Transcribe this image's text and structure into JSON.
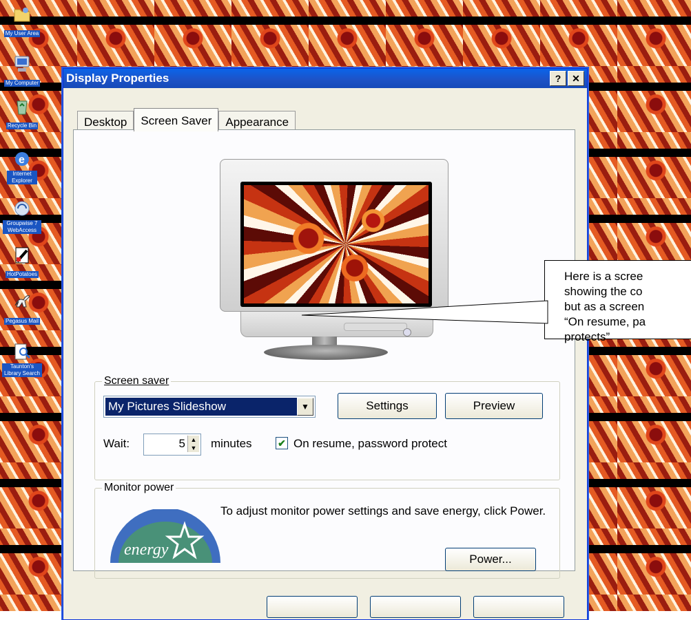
{
  "desktop_icons": [
    {
      "label": "My User Area",
      "icon": "folder-user-icon"
    },
    {
      "label": "My Computer",
      "icon": "computer-icon"
    },
    {
      "label": "Recycle Bin",
      "icon": "recycle-bin-icon"
    },
    {
      "label": "Internet Explorer",
      "icon": "internet-explorer-icon"
    },
    {
      "label": "Groupwise 7 WebAccess",
      "icon": "groupwise-icon"
    },
    {
      "label": "HotPotatoes",
      "icon": "hotpotatoes-icon"
    },
    {
      "label": "Pegasus Mail",
      "icon": "pegasus-mail-icon"
    },
    {
      "label": "Taunton's Library Search",
      "icon": "library-search-icon"
    }
  ],
  "window": {
    "title": "Display Properties",
    "help_label": "?",
    "close_label": "✕"
  },
  "tabs": [
    {
      "label": "Desktop",
      "active": false
    },
    {
      "label": "Screen Saver",
      "active": true
    },
    {
      "label": "Appearance",
      "active": false
    }
  ],
  "screen_saver": {
    "group_label": "Screen saver",
    "selected": "My Pictures Slideshow",
    "settings_label": "Settings",
    "preview_label": "Preview",
    "wait_label": "Wait:",
    "wait_value": "5",
    "minutes_label": "minutes",
    "password_protect_label": "On resume, password protect",
    "password_protect_checked": true
  },
  "monitor_power": {
    "group_label": "Monitor power",
    "text": "To adjust monitor power settings and save energy, click Power.",
    "power_label": "Power...",
    "logo_text": "energy"
  },
  "callout": {
    "line1": "Here is a scree",
    "line2": "showing the co",
    "line3": "but as a screen",
    "line4": "“On resume, pa",
    "line5": "protects”"
  },
  "colors": {
    "titlebar": "#0a64ea",
    "selection": "#0a246a",
    "icon_label_bg": "#1a55c2"
  }
}
